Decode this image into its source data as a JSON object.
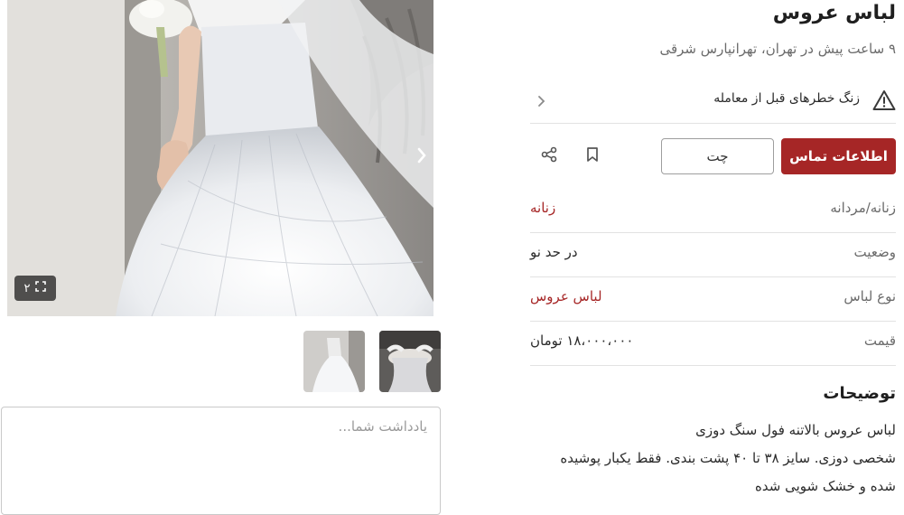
{
  "listing": {
    "title": "لباس عروس",
    "subtitle": "۹ ساعت پیش در تهران، تهرانپارس شرقی"
  },
  "warning": {
    "text": "زنگ خطرهای قبل از معامله",
    "icon": "warning-triangle-icon"
  },
  "actions": {
    "contact_label": "اطلاعات تماس",
    "chat_label": "چت",
    "bookmark_icon": "bookmark-icon",
    "share_icon": "share-icon"
  },
  "attributes": [
    {
      "key": "زنانه/مردانه",
      "value": "زنانه"
    },
    {
      "key": "وضعیت",
      "value": "در حد نو"
    },
    {
      "key": "نوع لباس",
      "value": "لباس عروس"
    },
    {
      "key": "قیمت",
      "value": "۱۸،۰۰۰،۰۰۰ تومان"
    }
  ],
  "description": {
    "title": "توضیحات",
    "lines": [
      "لباس عروس بالاتنه فول سنگ دوزی",
      "شخصی دوزی. سایز ۳۸ تا ۴۰ پشت بندی. فقط یکبار پوشیده",
      "شده و خشک شویی شده"
    ]
  },
  "gallery": {
    "counter": "۲",
    "expand_icon": "fullscreen-icon",
    "next_icon": "chevron-right-icon"
  },
  "note": {
    "placeholder": "یادداشت شما..."
  },
  "colors": {
    "brand": "#a62626",
    "divider": "#e2e2e2",
    "muted_text": "#6b6b6b"
  }
}
